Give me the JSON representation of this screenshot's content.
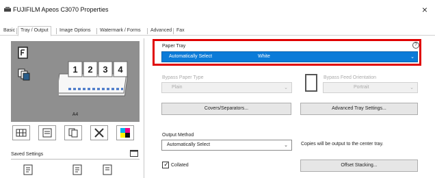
{
  "window": {
    "title": "FUJIFILM Apeos C3070 Properties",
    "close_glyph": "×",
    "app_icon": "printer-icon"
  },
  "tabs": [
    {
      "label": "Basic",
      "active": false
    },
    {
      "label": "Tray / Output",
      "active": true
    },
    {
      "label": "Image Options",
      "active": false
    },
    {
      "label": "Watermark / Forms",
      "active": false
    },
    {
      "label": "Advanced",
      "active": false
    },
    {
      "label": "Fax",
      "active": false
    }
  ],
  "preview": {
    "page_numbers": [
      "1",
      "2",
      "3",
      "4"
    ],
    "paper_size": "A4",
    "icons": [
      "simplex-page-icon",
      "copies-icon"
    ]
  },
  "toolbar": {
    "icons": [
      "grid-layout-icon",
      "tray-icon",
      "copies-stack-icon",
      "tools-icon",
      "color-icon"
    ]
  },
  "saved_settings": {
    "label": "Saved Settings",
    "icon": "saved-settings-icon",
    "items": [
      "document-icon",
      "document-icon",
      "document-icon"
    ]
  },
  "paper_tray": {
    "label": "Paper Tray",
    "value": "Automatically Select",
    "color": "White",
    "help_glyph": "?",
    "chevron": "⌄",
    "highlight_color": "#e00000",
    "select_color": "#0b7bd8"
  },
  "bypass_paper_type": {
    "label": "Bypass Paper Type",
    "value": "Plain",
    "chevron": "⌄"
  },
  "bypass_feed_orientation": {
    "label": "Bypass Feed Orientation",
    "value": "Portrait",
    "chevron": "⌄"
  },
  "buttons": {
    "covers": "Covers/Separators...",
    "advanced_tray": "Advanced Tray Settings...",
    "offset_stacking": "Offset Stacking..."
  },
  "output_method": {
    "label": "Output Method",
    "value": "Automatically Select",
    "chevron": "⌄",
    "note": "Copies will be output to the center tray."
  },
  "collated": {
    "label": "Collated",
    "checked": true,
    "check_glyph": "✓"
  }
}
